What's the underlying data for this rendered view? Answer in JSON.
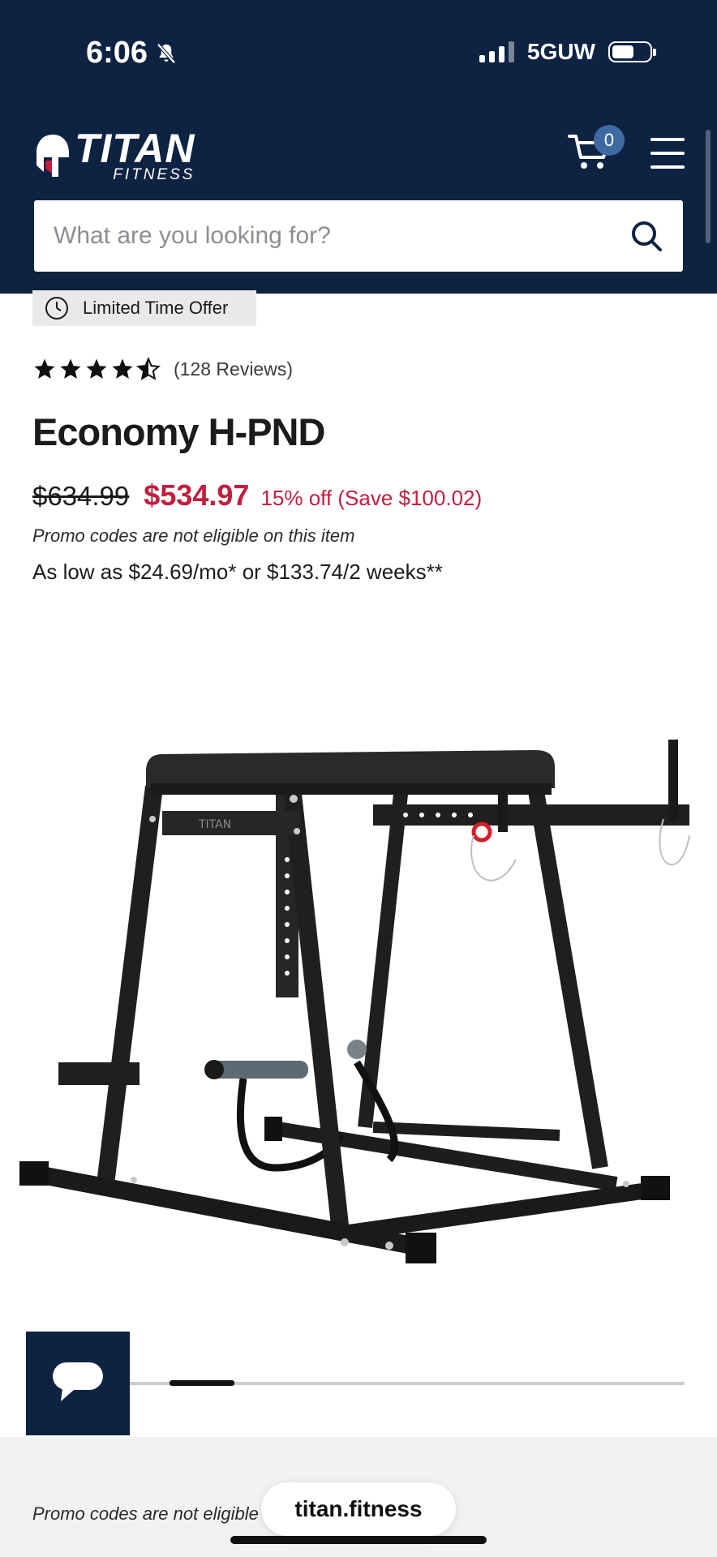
{
  "status_bar": {
    "time": "6:06",
    "network": "5GUW"
  },
  "header": {
    "logo_main": "TITAN",
    "logo_sub": "FITNESS",
    "cart_count": "0",
    "search_placeholder": "What are you looking for?"
  },
  "offer": {
    "label": "Limited Time Offer"
  },
  "rating": {
    "stars": 4.5,
    "reviews": "(128 Reviews)"
  },
  "product": {
    "title": "Economy H-PND",
    "old_price": "$634.99",
    "new_price": "$534.97",
    "discount": "15% off (Save $100.02)",
    "promo_note": "Promo codes are not eligible on this item",
    "financing": "As low as $24.69/mo* or $133.74/2 weeks**",
    "image_brand_label": "TITAN"
  },
  "gallery": {
    "position": 0.13
  },
  "bottom": {
    "promo_partial": "Promo codes are not eligible",
    "url": "titan.fitness"
  },
  "colors": {
    "header_bg": "#0e2242",
    "sale_red": "#c21f3e",
    "badge_blue": "#3d6aa0"
  },
  "icons": [
    "muted-bell-icon",
    "cart-icon",
    "menu-icon",
    "search-icon",
    "clock-icon",
    "star-icon",
    "chat-icon"
  ]
}
